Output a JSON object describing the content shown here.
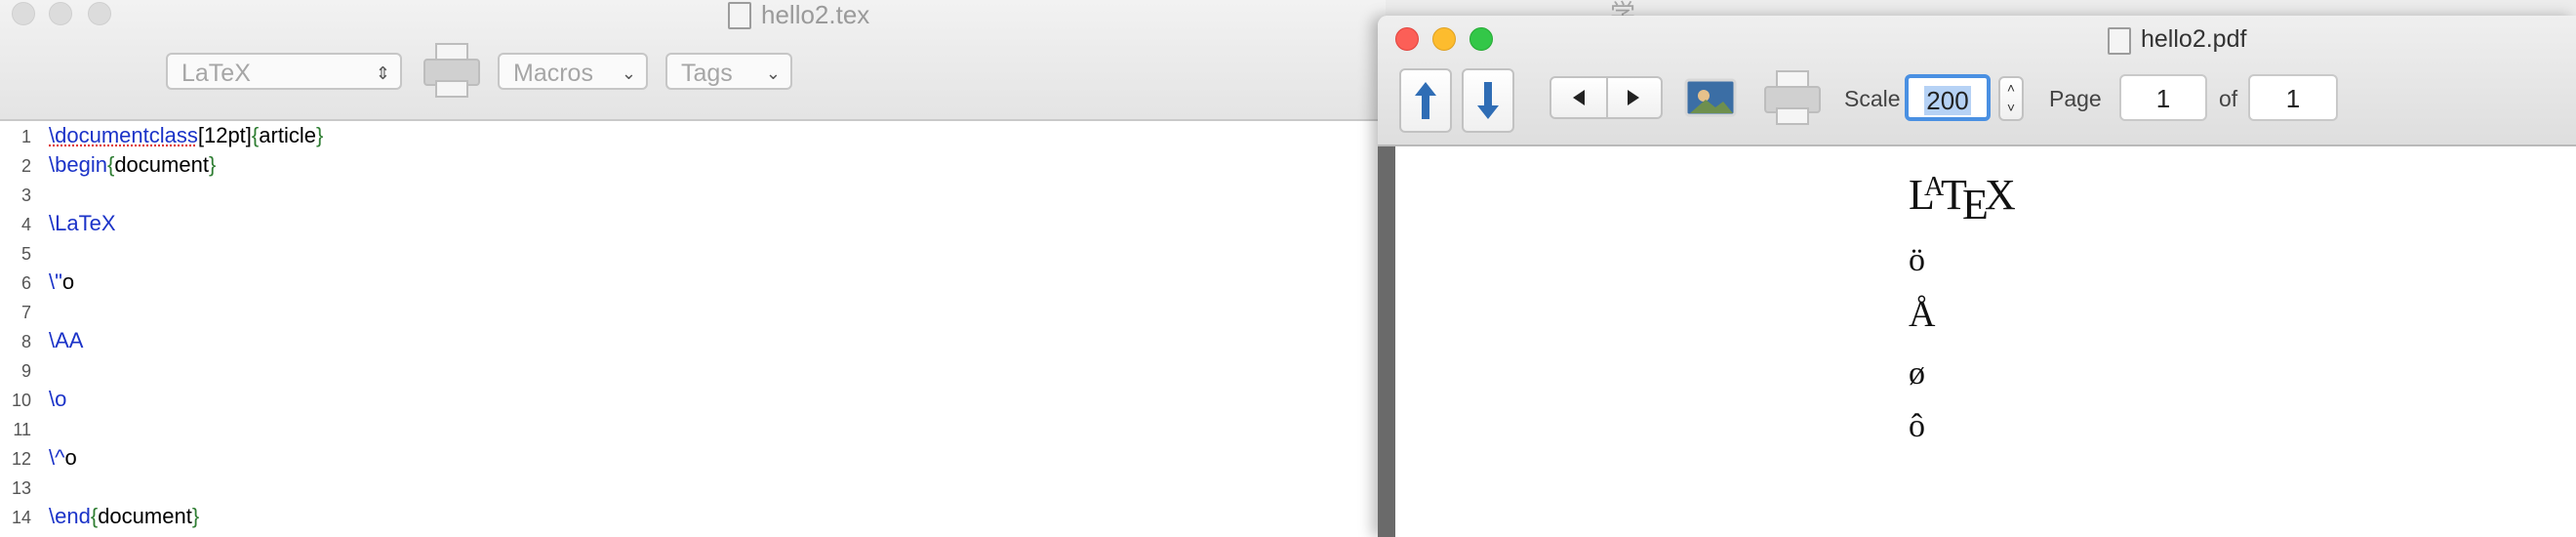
{
  "editor": {
    "title": "hello2.tex",
    "toolbar": {
      "typeset_engine": "LaTeX",
      "macros_label": "Macros",
      "tags_label": "Tags"
    },
    "lines": [
      {
        "n": "1"
      },
      {
        "n": "2"
      },
      {
        "n": "3"
      },
      {
        "n": "4"
      },
      {
        "n": "5"
      },
      {
        "n": "6"
      },
      {
        "n": "7"
      },
      {
        "n": "8"
      },
      {
        "n": "9"
      },
      {
        "n": "10"
      },
      {
        "n": "11"
      },
      {
        "n": "12"
      },
      {
        "n": "13"
      },
      {
        "n": "14"
      }
    ],
    "code": {
      "l1_cmd": "\\documentclass",
      "l1_opt": "[12pt]",
      "l1_ob": "{",
      "l1_arg": "article",
      "l1_cb": "}",
      "l2_cmd": "\\begin",
      "l2_ob": "{",
      "l2_arg": "document",
      "l2_cb": "}",
      "l4": "\\LaTeX",
      "l6_cmd": "\\\"",
      "l6_rest": "o",
      "l8": "\\AA",
      "l10": "\\o",
      "l12_cmd": "\\^",
      "l12_rest": "o",
      "l14_cmd": "\\end",
      "l14_ob": "{",
      "l14_arg": "document",
      "l14_cb": "}"
    }
  },
  "background_window_title": "学习.md",
  "pdf_viewer": {
    "title": "hello2.pdf",
    "scale_label": "Scale",
    "scale_value": "200",
    "page_label": "Page",
    "page_value": "1",
    "of_label": "of",
    "total_pages": "1"
  },
  "rendered": {
    "latex_L": "L",
    "latex_A": "A",
    "latex_T": "T",
    "latex_E": "E",
    "latex_X": "X",
    "o_umlaut": "ö",
    "a_ring": "Å",
    "o_slash": "ø",
    "o_circ": "ô"
  },
  "colors": {
    "close": "#fc5f57",
    "minimize": "#fdbc2e",
    "zoom": "#33c748",
    "command": "#1b33c8",
    "brace": "#2e7d32",
    "scale_highlight": "#4a90e2"
  }
}
